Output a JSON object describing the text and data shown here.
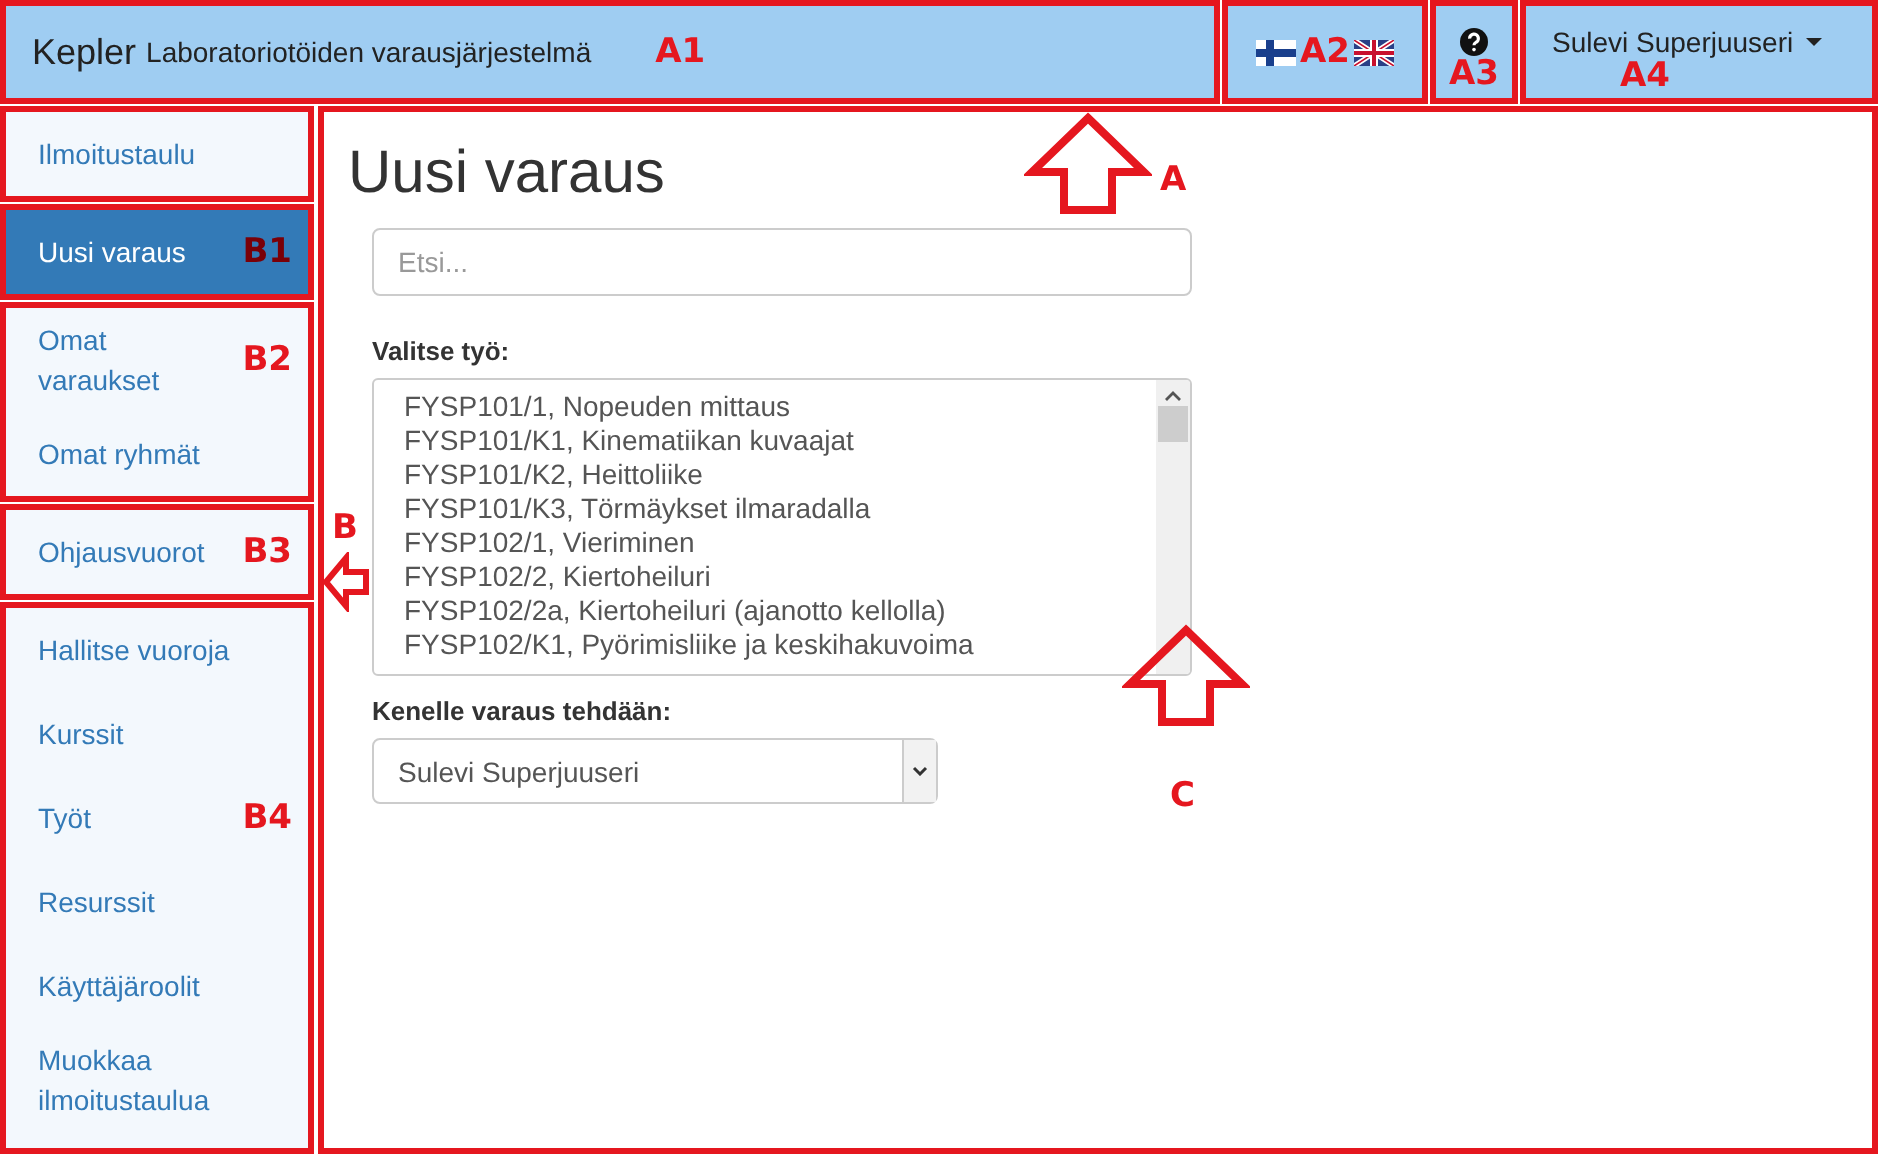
{
  "header": {
    "brand": "Kepler",
    "subtitle": "Laboratoriotöiden varausjärjestelmä",
    "annotation": "A1"
  },
  "languages": {
    "annotation": "A2"
  },
  "help": {
    "annotation": "A3"
  },
  "user_menu": {
    "name": "Sulevi Superjuuseri",
    "annotation": "A4"
  },
  "sidebar": {
    "groups": [
      {
        "items": [
          {
            "label": "Ilmoitustaulu",
            "selected": false
          }
        ]
      },
      {
        "annotation": "B1",
        "items": [
          {
            "label": "Uusi varaus",
            "selected": true
          }
        ]
      },
      {
        "annotation": "B2",
        "items": [
          {
            "label": "Omat varaukset",
            "selected": false
          },
          {
            "label": "Omat ryhmät",
            "selected": false
          }
        ]
      },
      {
        "annotation": "B3",
        "items": [
          {
            "label": "Ohjausvuorot",
            "selected": false
          }
        ]
      },
      {
        "annotation": "B4",
        "items": [
          {
            "label": "Hallitse vuoroja",
            "selected": false
          },
          {
            "label": "Kurssit",
            "selected": false
          },
          {
            "label": "Työt",
            "selected": false
          },
          {
            "label": "Resurssit",
            "selected": false
          },
          {
            "label": "Käyttäjäroolit",
            "selected": false
          },
          {
            "label": "Muokkaa ilmoitustaulua",
            "selected": false
          }
        ]
      }
    ]
  },
  "main": {
    "title": "Uusi varaus",
    "search": {
      "placeholder": "Etsi..."
    },
    "job_label": "Valitse työ:",
    "jobs": [
      "FYSP101/1, Nopeuden mittaus",
      "FYSP101/K1, Kinematiikan kuvaajat",
      "FYSP101/K2, Heittoliike",
      "FYSP101/K3, Törmäykset ilmaradalla",
      "FYSP102/1, Vieriminen",
      "FYSP102/2, Kiertoheiluri",
      "FYSP102/2a, Kiertoheiluri (ajanotto kellolla)",
      "FYSP102/K1, Pyörimisliike ja keskihakuvoima"
    ],
    "person_label": "Kenelle varaus tehdään:",
    "person_value": "Sulevi Superjuuseri"
  },
  "arrows": [
    {
      "label": "A",
      "kind": "up"
    },
    {
      "label": "B",
      "kind": "left"
    },
    {
      "label": "C",
      "kind": "up"
    }
  ]
}
